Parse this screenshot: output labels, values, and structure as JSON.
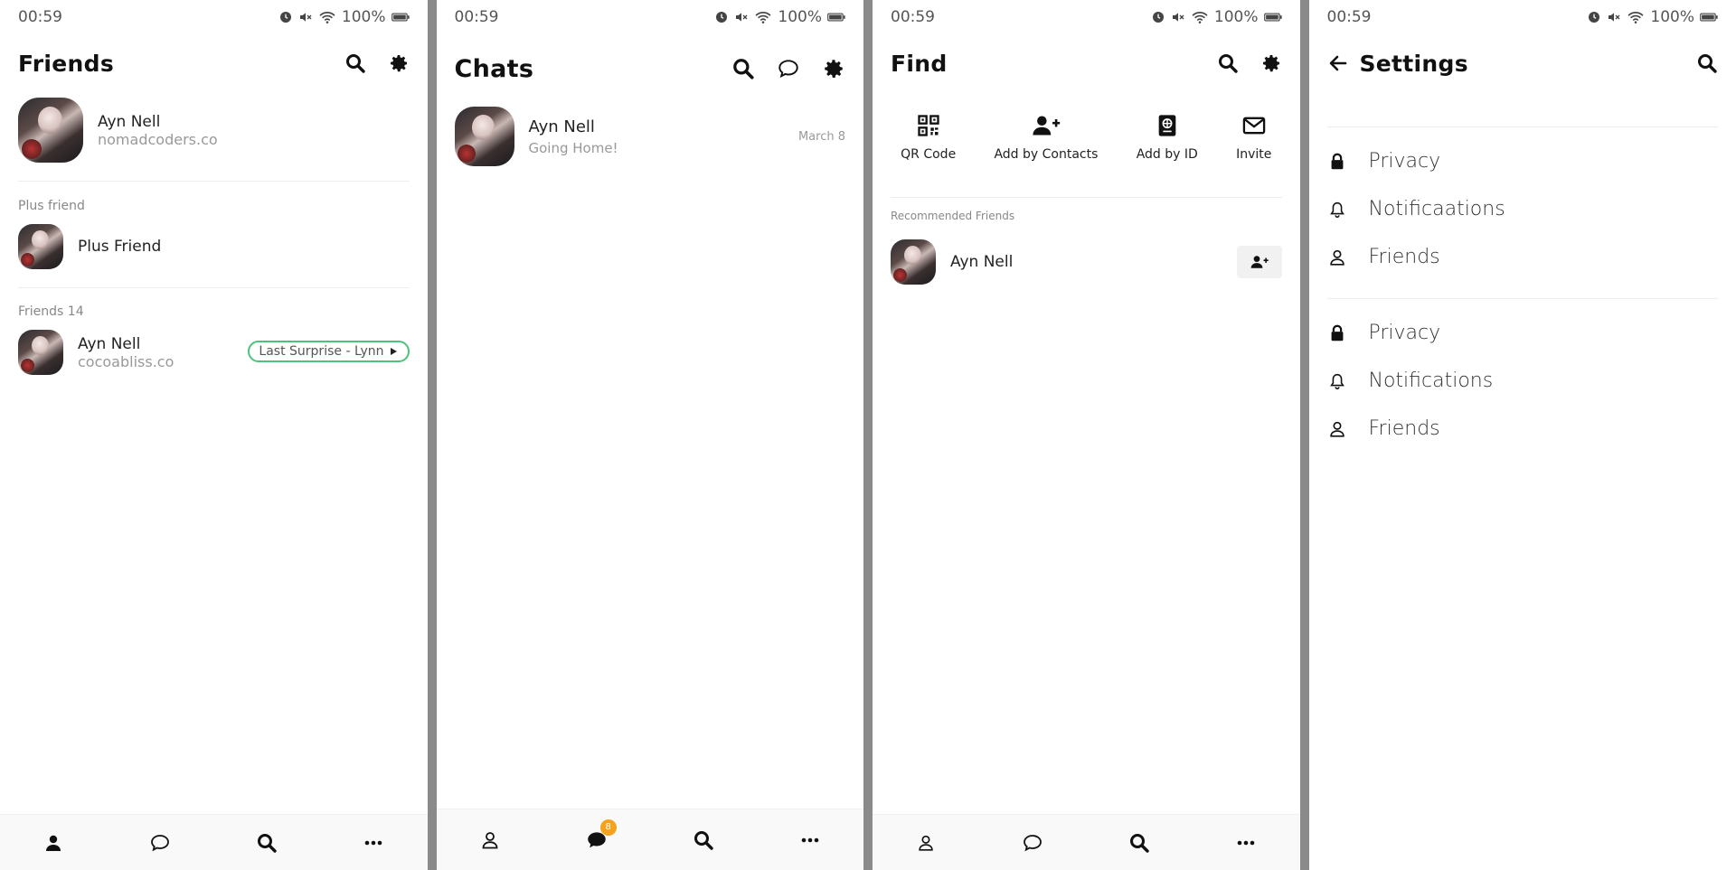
{
  "status": {
    "time": "00:59",
    "battery": "100%"
  },
  "friends": {
    "title": "Friends",
    "me": {
      "name": "Ayn Nell",
      "sub": "nomadcoders.co"
    },
    "plus_label": "Plus friend",
    "plus": {
      "name": "Plus Friend"
    },
    "friends_label": "Friends 14",
    "friend": {
      "name": "Ayn Nell",
      "sub": "cocoabliss.co",
      "music": "Last Surprise - Lynn"
    }
  },
  "chats": {
    "title": "Chats",
    "item": {
      "name": "Ayn Nell",
      "preview": "Going Home!",
      "date": "March 8"
    },
    "badge": "8"
  },
  "find": {
    "title": "Find",
    "actions": [
      {
        "label": "QR Code",
        "icon": "qr-code-icon"
      },
      {
        "label": "Add by Contacts",
        "icon": "user-plus-icon"
      },
      {
        "label": "Add by ID",
        "icon": "id-book-icon"
      },
      {
        "label": "Invite",
        "icon": "envelope-icon"
      }
    ],
    "recommended_label": "Recommended Friends",
    "recommended": {
      "name": "Ayn Nell"
    }
  },
  "settings": {
    "title": "Settings",
    "group1": [
      {
        "label": "Privacy",
        "icon": "lock-icon"
      },
      {
        "label": "Notificaations",
        "icon": "bell-icon"
      },
      {
        "label": "Friends",
        "icon": "user-icon"
      }
    ],
    "group2": [
      {
        "label": "Privacy",
        "icon": "lock-icon"
      },
      {
        "label": "Notifications",
        "icon": "bell-icon"
      },
      {
        "label": "Friends",
        "icon": "user-icon"
      }
    ]
  },
  "colors": {
    "accent_green": "#4cc37a",
    "badge_orange": "#f5a21c"
  }
}
